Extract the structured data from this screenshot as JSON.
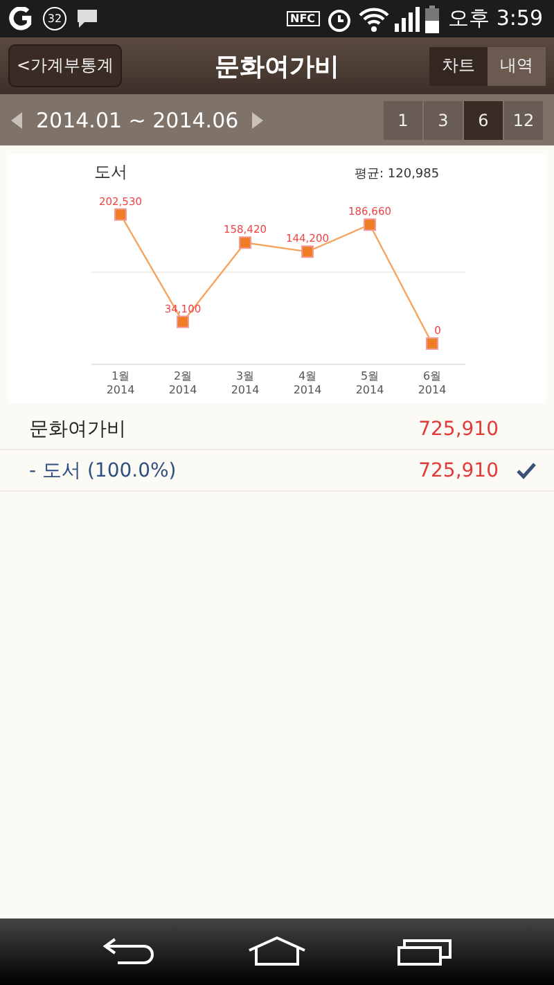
{
  "status_bar": {
    "badge": "32",
    "nfc": "NFC",
    "time": "오후 3:59"
  },
  "header": {
    "back": "<가계부통계",
    "title": "문화여가비",
    "tabs": [
      {
        "label": "차트",
        "selected": true
      },
      {
        "label": "내역",
        "selected": false
      }
    ]
  },
  "period": {
    "range": "2014.01 ~ 2014.06",
    "options": [
      {
        "label": "1",
        "selected": false
      },
      {
        "label": "3",
        "selected": false
      },
      {
        "label": "6",
        "selected": true
      },
      {
        "label": "12",
        "selected": false
      }
    ]
  },
  "chart": {
    "average": "평균: 120,985",
    "chart_data": {
      "type": "line",
      "title": "도서",
      "categories": [
        "1월 2014",
        "2월 2014",
        "3월 2014",
        "4월 2014",
        "5월 2014",
        "6월 2014"
      ],
      "values": [
        202530,
        34100,
        158420,
        144200,
        186660,
        0
      ],
      "marker": "square",
      "value_labels": [
        "202,530",
        "34,100",
        "158,420",
        "144,200",
        "186,660",
        "0"
      ]
    }
  },
  "list": [
    {
      "kind": "total",
      "label": "문화여가비",
      "amount": "725,910",
      "checked": false
    },
    {
      "kind": "sub",
      "label": "- 도서 (100.0%)",
      "amount": "725,910",
      "checked": true
    }
  ]
}
